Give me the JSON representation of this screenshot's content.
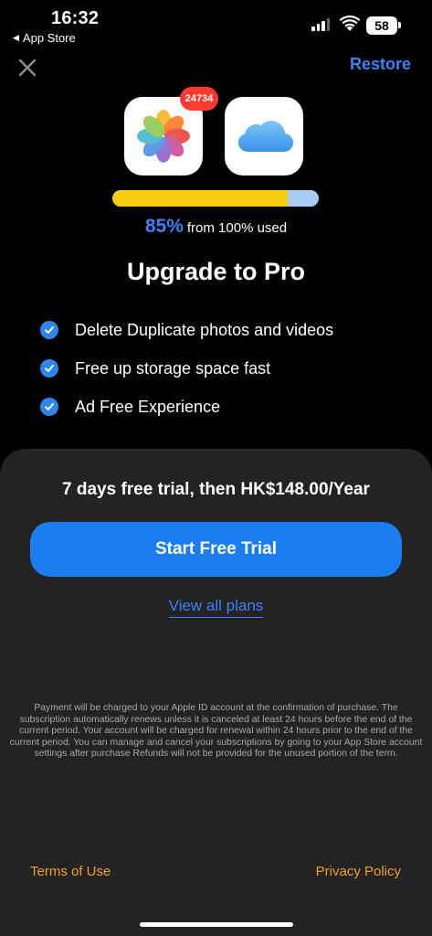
{
  "status_bar": {
    "time": "16:32",
    "back_label": "App Store",
    "battery": "58"
  },
  "header": {
    "restore_label": "Restore"
  },
  "apps": {
    "photos_badge": "24734"
  },
  "storage": {
    "percent_label": "85%",
    "used_text": "from 100% used",
    "fill_fraction": 0.85
  },
  "title": "Upgrade to Pro",
  "features": [
    "Delete Duplicate photos and videos",
    "Free up storage space fast",
    "Ad Free Experience"
  ],
  "offer": {
    "trial_text": "7 days free trial, then HK$148.00/Year",
    "cta_label": "Start Free Trial",
    "plans_link": "View all plans",
    "legal_text": "Payment will be charged to your Apple ID account at the confirmation of purchase. The subscription automatically renews unless it is canceled at least 24 hours before the end of the current period. Your account will be charged for renewal within 24 hours prior to the end of the current period. You can manage and cancel your subscriptions by going to your App Store account settings after purchase Refunds will not be provided for the unused portion of the term.",
    "terms_label": "Terms of Use",
    "privacy_label": "Privacy Policy"
  },
  "colors": {
    "accent": "#1a7df0",
    "progress_fill": "#f6ce0f",
    "progress_track": "#a9cdf5",
    "link_orange": "#f0a020",
    "sheet_bg": "#232323"
  }
}
